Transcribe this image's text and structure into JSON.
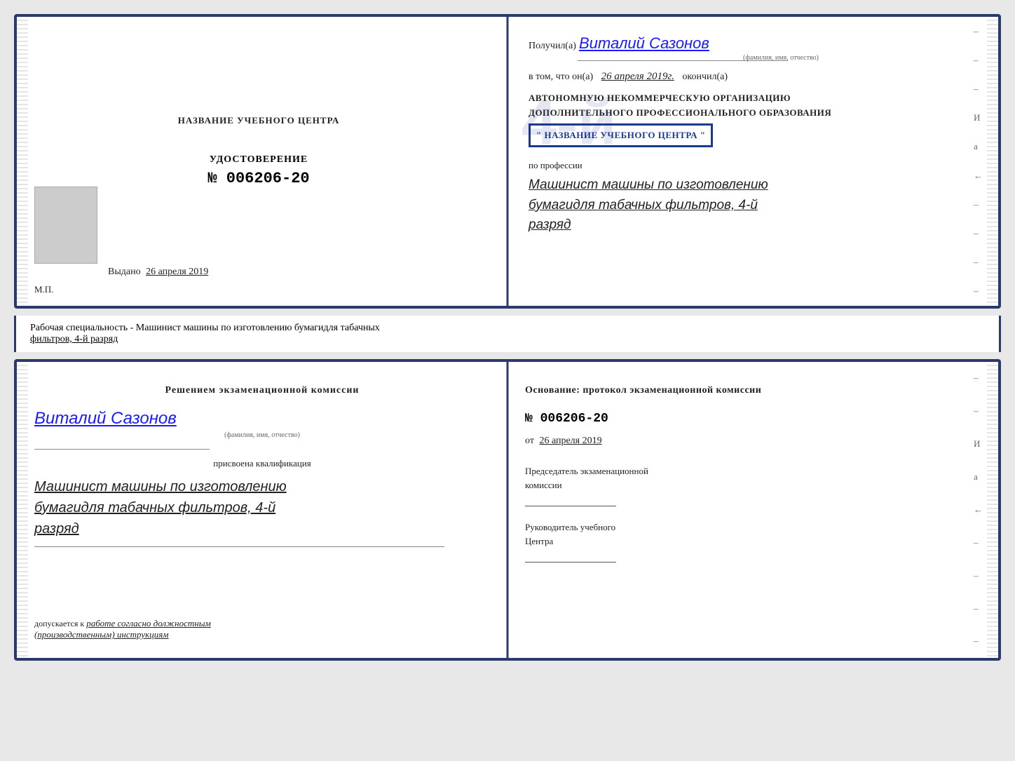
{
  "top_left": {
    "center_title": "НАЗВАНИЕ УЧЕБНОГО ЦЕНТРА",
    "udost_label": "УДОСТОВЕРЕНИЕ",
    "udost_number": "№ 006206-20",
    "vydano_label": "Выдано",
    "vydano_date": "26 апреля 2019",
    "mp": "М.П."
  },
  "top_right": {
    "poluchil_prefix": "Получил(а)",
    "poluchil_name": "Виталий Сазонов",
    "poluchil_subtitle": "(фамилия, имя, отчество)",
    "vtom_prefix": "в том, что он(а)",
    "vtom_date": "26 апреля 2019г.",
    "okochil": "окончил(а)",
    "org_line1": "АВТОНОМНУЮ НЕКОММЕРЧЕСКУЮ ОРГАНИЗАЦИЮ",
    "org_line2": "ДОПОЛНИТЕЛЬНОГО ПРОФЕССИОНАЛЬНОГО ОБРАЗОВАНИЯ",
    "stamp_text": "\" НАЗВАНИЕ УЧЕБНОГО ЦЕНТРА \"",
    "po_professii": "по профессии",
    "profession_line1": "Машинист машины по изготовлению",
    "profession_line2": "бумагидля табачных фильтров, 4-й",
    "profession_line3": "разряд"
  },
  "info_bar": {
    "text": "Рабочая специальность - Машинист машины по изготовлению бумагидля табачных",
    "text2": "фильтров, 4-й разряд"
  },
  "bottom_left": {
    "section_title": "Решением  экзаменационной  комиссии",
    "person_name": "Виталий Сазонов",
    "name_subtitle": "(фамилия, имя, отчество)",
    "prisvoena": "присвоена квалификация",
    "qual_line1": "Машинист машины по изготовлению",
    "qual_line2": "бумагидля табачных фильтров, 4-й",
    "qual_line3": "разряд",
    "dopusk_prefix": "допускается к",
    "dopusk_text": "работе согласно должностным",
    "dopusk_text2": "(производственным) инструкциям"
  },
  "bottom_right": {
    "osnovanie": "Основание:  протокол  экзаменационной  комиссии",
    "number": "№  006206-20",
    "ot_prefix": "от",
    "ot_date": "26 апреля 2019",
    "predsedatel_label": "Председатель экзаменационной",
    "predsedatel_label2": "комиссии",
    "rukovoditel_label": "Руководитель учебного",
    "rukovoditel_label2": "Центра"
  },
  "big_number": "4-й",
  "dashes_right_top": [
    "-",
    "-",
    "-",
    "И",
    "а",
    "←",
    "-",
    "-",
    "-",
    "-"
  ],
  "dashes_right_bottom": [
    "-",
    "-",
    "И",
    "а",
    "←",
    "-",
    "-",
    "-",
    "-"
  ]
}
